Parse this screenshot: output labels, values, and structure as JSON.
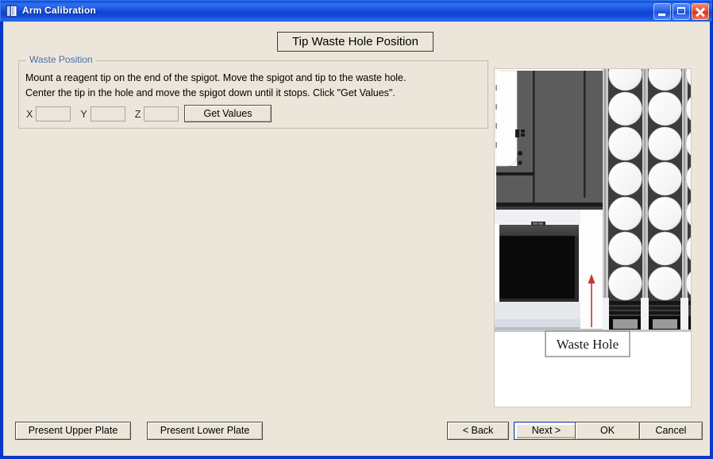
{
  "window": {
    "title": "Arm Calibration",
    "icon": "app-window-icon",
    "controls": {
      "minimize": "minimize-icon",
      "maximize": "maximize-icon",
      "close": "close-icon"
    },
    "frame_color": "#0a38c8",
    "titlebar_color": "#1a54e0",
    "client_bg": "#ece6da"
  },
  "header": {
    "title": "Tip Waste Hole Position"
  },
  "group": {
    "legend": "Waste Position",
    "legend_color": "#4a6fa5",
    "instructions": "Mount a reagent tip on the end of the spigot.  Move the spigot and tip to the waste hole.\nCenter the tip in the hole and move the spigot down until it stops.  Click \"Get Values\".",
    "fields": [
      {
        "label": "X",
        "value": "",
        "placeholder": ""
      },
      {
        "label": "Y",
        "value": "",
        "placeholder": ""
      },
      {
        "label": "Z",
        "value": "",
        "placeholder": ""
      }
    ],
    "get_values_label": "Get Values"
  },
  "photo": {
    "callout_label": "Waste Hole",
    "arrow_color": "#c0392b",
    "description": "Photograph of instrument deck showing gray spigot assembly at left, black waste bin, and racks of white circular sample tubes at right"
  },
  "buttons": {
    "present_upper_plate": "Present Upper Plate",
    "present_lower_plate": "Present Lower Plate",
    "back": "< Back",
    "next": "Next >",
    "ok": "OK",
    "cancel": "Cancel",
    "default_button": "Next >"
  }
}
